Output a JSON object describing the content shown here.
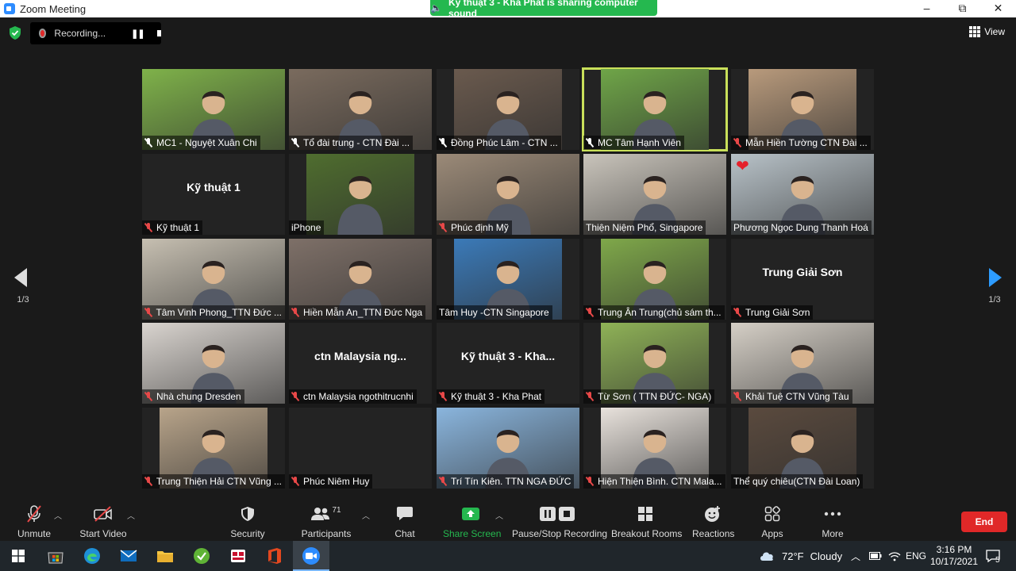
{
  "window": {
    "title": "Zoom Meeting",
    "min": "–",
    "restore": "⧉",
    "close": "✕"
  },
  "share_banner": "Kỹ thuật 3 - Kha Phat is sharing computer sound",
  "recording": {
    "label": "Recording...",
    "pause": "❚❚"
  },
  "view_label": "View",
  "page_indicator": {
    "left": "1/3",
    "right": "1/3"
  },
  "tiles": [
    {
      "label": "MC1 - Nguyệt Xuân Chi",
      "mic": "pin",
      "kind": "video",
      "bg": "#7fb24a"
    },
    {
      "label": "Tổ đài trung - CTN Đài ...",
      "mic": "pin",
      "kind": "video",
      "bg": "#7a6b5e"
    },
    {
      "label": "Đồng Phúc Lâm - CTN ...",
      "mic": "pin",
      "kind": "video",
      "bg": "#6a5a4e"
    },
    {
      "label": "MC Tâm Hạnh Viên",
      "mic": "pin",
      "kind": "video",
      "bg": "#6fa548",
      "active": true
    },
    {
      "label": "Mẫn Hiền Tường CTN Đài ...",
      "mic": "muted",
      "kind": "video",
      "bg": "#b89a7c"
    },
    {
      "label": "Kỹ thuật 1",
      "mic": "muted",
      "kind": "name",
      "display": "Kỹ thuật 1"
    },
    {
      "label": "iPhone",
      "mic": "none",
      "kind": "video",
      "bg": "#4f6d2f"
    },
    {
      "label": "Phúc định Mỹ",
      "mic": "muted",
      "kind": "video",
      "bg": "#9b8a78"
    },
    {
      "label": "Thiện Niệm Phổ, Singapore",
      "mic": "none",
      "kind": "video",
      "bg": "#c9c4bb"
    },
    {
      "label": "Phương Ngọc Dung Thanh Hoá",
      "mic": "none",
      "kind": "video",
      "bg": "#b8c2c8",
      "heart": "❤"
    },
    {
      "label": "Tâm Vinh Phong_TTN Đức ...",
      "mic": "muted",
      "kind": "video",
      "bg": "#c6bfb1"
    },
    {
      "label": "Hiền Mẫn An_TTN Đức Nga",
      "mic": "muted",
      "kind": "video",
      "bg": "#7e7068"
    },
    {
      "label": "Tâm Huy -CTN Singapore",
      "mic": "none",
      "kind": "video",
      "bg": "#3b7ab8"
    },
    {
      "label": "Trung Ân Trung(chủ sám th...",
      "mic": "muted",
      "kind": "video",
      "bg": "#7fa84a"
    },
    {
      "label": "Trung Giải Sơn",
      "mic": "muted",
      "kind": "name",
      "display": "Trung Giải Sơn"
    },
    {
      "label": "Nhà chung Dresden",
      "mic": "muted",
      "kind": "video",
      "bg": "#d9d4cf"
    },
    {
      "label": "ctn Malaysia ngothitrucnhi",
      "mic": "muted",
      "kind": "name",
      "display": "ctn  Malaysia  ng..."
    },
    {
      "label": "Kỹ thuật 3 - Kha Phat",
      "mic": "muted",
      "kind": "name",
      "display": "Kỹ thuật 3 - Kha..."
    },
    {
      "label": "Từ Sơn ( TTN ĐỨC- NGA)",
      "mic": "muted",
      "kind": "video",
      "bg": "#8fb257"
    },
    {
      "label": "Khải Tuệ CTN Vũng Tàu",
      "mic": "muted",
      "kind": "video",
      "bg": "#d5cfc6"
    },
    {
      "label": "Trung Thiện Hải CTN Vũng ...",
      "mic": "muted",
      "kind": "video",
      "bg": "#b8a48a"
    },
    {
      "label": "Phúc Niêm Huy",
      "mic": "muted",
      "kind": "blank"
    },
    {
      "label": "Trí Tín Kiên. TTN NGA ĐỨC",
      "mic": "muted",
      "kind": "video",
      "bg": "#8ab5dd"
    },
    {
      "label": "Hiện Thiện Bình. CTN Mala...",
      "mic": "muted",
      "kind": "video",
      "bg": "#e8e2dc"
    },
    {
      "label": "Thể quý chiêu(CTN Đài Loan)",
      "mic": "none",
      "kind": "video",
      "bg": "#5a4a3e"
    }
  ],
  "toolbar": {
    "unmute": "Unmute",
    "start_video": "Start Video",
    "security": "Security",
    "participants": "Participants",
    "participants_count": "71",
    "chat": "Chat",
    "share_screen": "Share Screen",
    "pause_stop_recording": "Pause/Stop Recording",
    "breakout_rooms": "Breakout Rooms",
    "reactions": "Reactions",
    "apps": "Apps",
    "more": "More",
    "end": "End"
  },
  "taskbar": {
    "weather_temp": "72°F",
    "weather_desc": "Cloudy",
    "language": "ENG",
    "time": "3:16 PM",
    "date": "10/17/2021",
    "notifications": "5"
  },
  "colors": {
    "accent": "#2d8cff",
    "share_green": "#25b84f",
    "end_red": "#e02828",
    "active_border": "#c9e05a"
  }
}
